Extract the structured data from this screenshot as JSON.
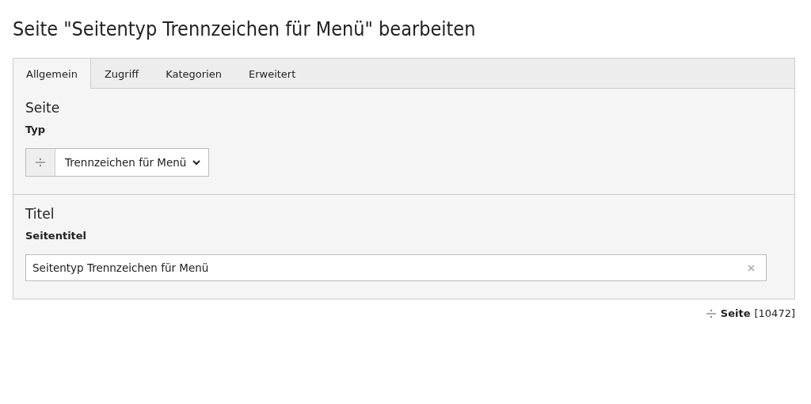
{
  "title": "Seite \"Seitentyp Trennzeichen für Menü\" bearbeiten",
  "tabs": [
    {
      "label": "Allgemein",
      "selected": true
    },
    {
      "label": "Zugriff",
      "selected": false
    },
    {
      "label": "Kategorien",
      "selected": false
    },
    {
      "label": "Erweitert",
      "selected": false
    }
  ],
  "sections": [
    {
      "heading": "Seite",
      "fields": [
        {
          "kind": "select",
          "label": "Typ",
          "value": "Trennzeichen für Menü"
        }
      ]
    },
    {
      "heading": "Titel",
      "fields": [
        {
          "kind": "text",
          "label": "Seitentitel",
          "value": "Seitentyp Trennzeichen für Menü"
        }
      ]
    }
  ],
  "footer": {
    "type_label": "Seite",
    "id": "[10472]"
  }
}
